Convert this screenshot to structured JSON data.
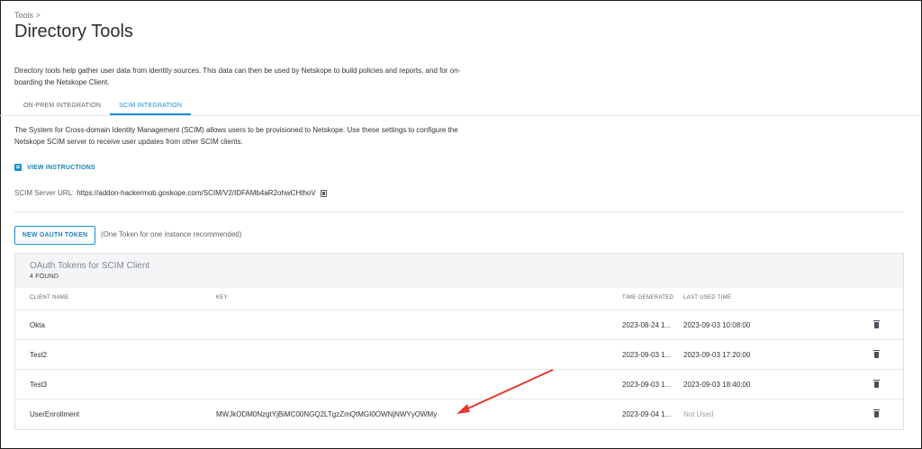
{
  "breadcrumb": "Tools >",
  "title": "Directory Tools",
  "intro": "Directory tools help gather user data from identity sources. This data can then be used by Netskope to build policies and reports, and for on-boarding the Netskope Client.",
  "tabs": [
    {
      "label": "ON-PREM INTEGRATION",
      "active": false
    },
    {
      "label": "SCIM INTEGRATION",
      "active": true
    }
  ],
  "scim_description": "The System for Cross-domain Identity Management (SCIM) allows users to be provisioned to Netskope. Use these settings to configure the Netskope SCIM server to receive user updates from other SCIM clients.",
  "view_instructions": "VIEW INSTRUCTIONS",
  "server_url": {
    "label": "SCIM Server URL:",
    "value": "https://addon-hackermob.goskope.com/SCIM/V2/IDFAMb4aR2ohwCHthoV"
  },
  "new_token_button": "NEW OAUTH TOKEN",
  "token_note": "(One Token for one instance recommended)",
  "panel": {
    "title": "OAuth Tokens for SCIM Client",
    "count": "4 FOUND",
    "columns": {
      "client_name": "CLIENT NAME",
      "key": "KEY",
      "time_generated": "TIME GENERATED",
      "last_used": "LAST USED TIME"
    },
    "rows": [
      {
        "client_name": "Okta",
        "key": "",
        "time_generated": "2023-08-24 1...",
        "last_used": "2023-09-03 10:08:00"
      },
      {
        "client_name": "Test2",
        "key": "",
        "time_generated": "2023-09-03 1...",
        "last_used": "2023-09-03 17:20:00"
      },
      {
        "client_name": "Test3",
        "key": "",
        "time_generated": "2023-09-03 1...",
        "last_used": "2023-09-03 18:40:00"
      },
      {
        "client_name": "UserEnrollment",
        "key": "MWJkODM0NzgtYjBiMC00NGQ2LTgzZmQtMGI0OWNjNWYyOWMy",
        "time_generated": "2023-09-04 1...",
        "last_used": "Not Used"
      }
    ]
  },
  "colors": {
    "accent": "#1a8fcf",
    "annotation_arrow": "#e8382b"
  },
  "icons": [
    "doc-icon",
    "copy-icon",
    "trash-icon"
  ]
}
